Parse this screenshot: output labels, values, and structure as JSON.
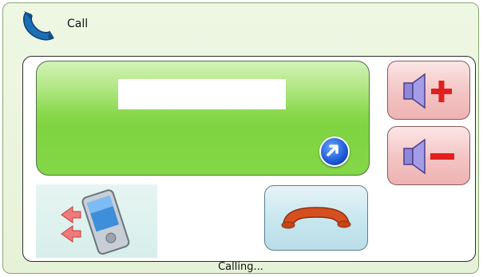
{
  "window": {
    "title": "Call",
    "title_icon": "phone-icon"
  },
  "display": {
    "number_value": "",
    "arrow_icon": "arrow-up-right-icon"
  },
  "buttons": {
    "volume_up_icon": "speaker-plus-icon",
    "volume_down_icon": "speaker-minus-icon",
    "handset_icon": "pda-phone-icon",
    "end_call_icon": "hang-up-icon"
  },
  "status": {
    "text": "Calling..."
  },
  "colors": {
    "window_background": "#e8f3dc",
    "display_green": "#84d748",
    "volume_button": "#f3c3c3",
    "end_call_button": "#c7e6ee",
    "handset_red": "#d43b1f"
  }
}
